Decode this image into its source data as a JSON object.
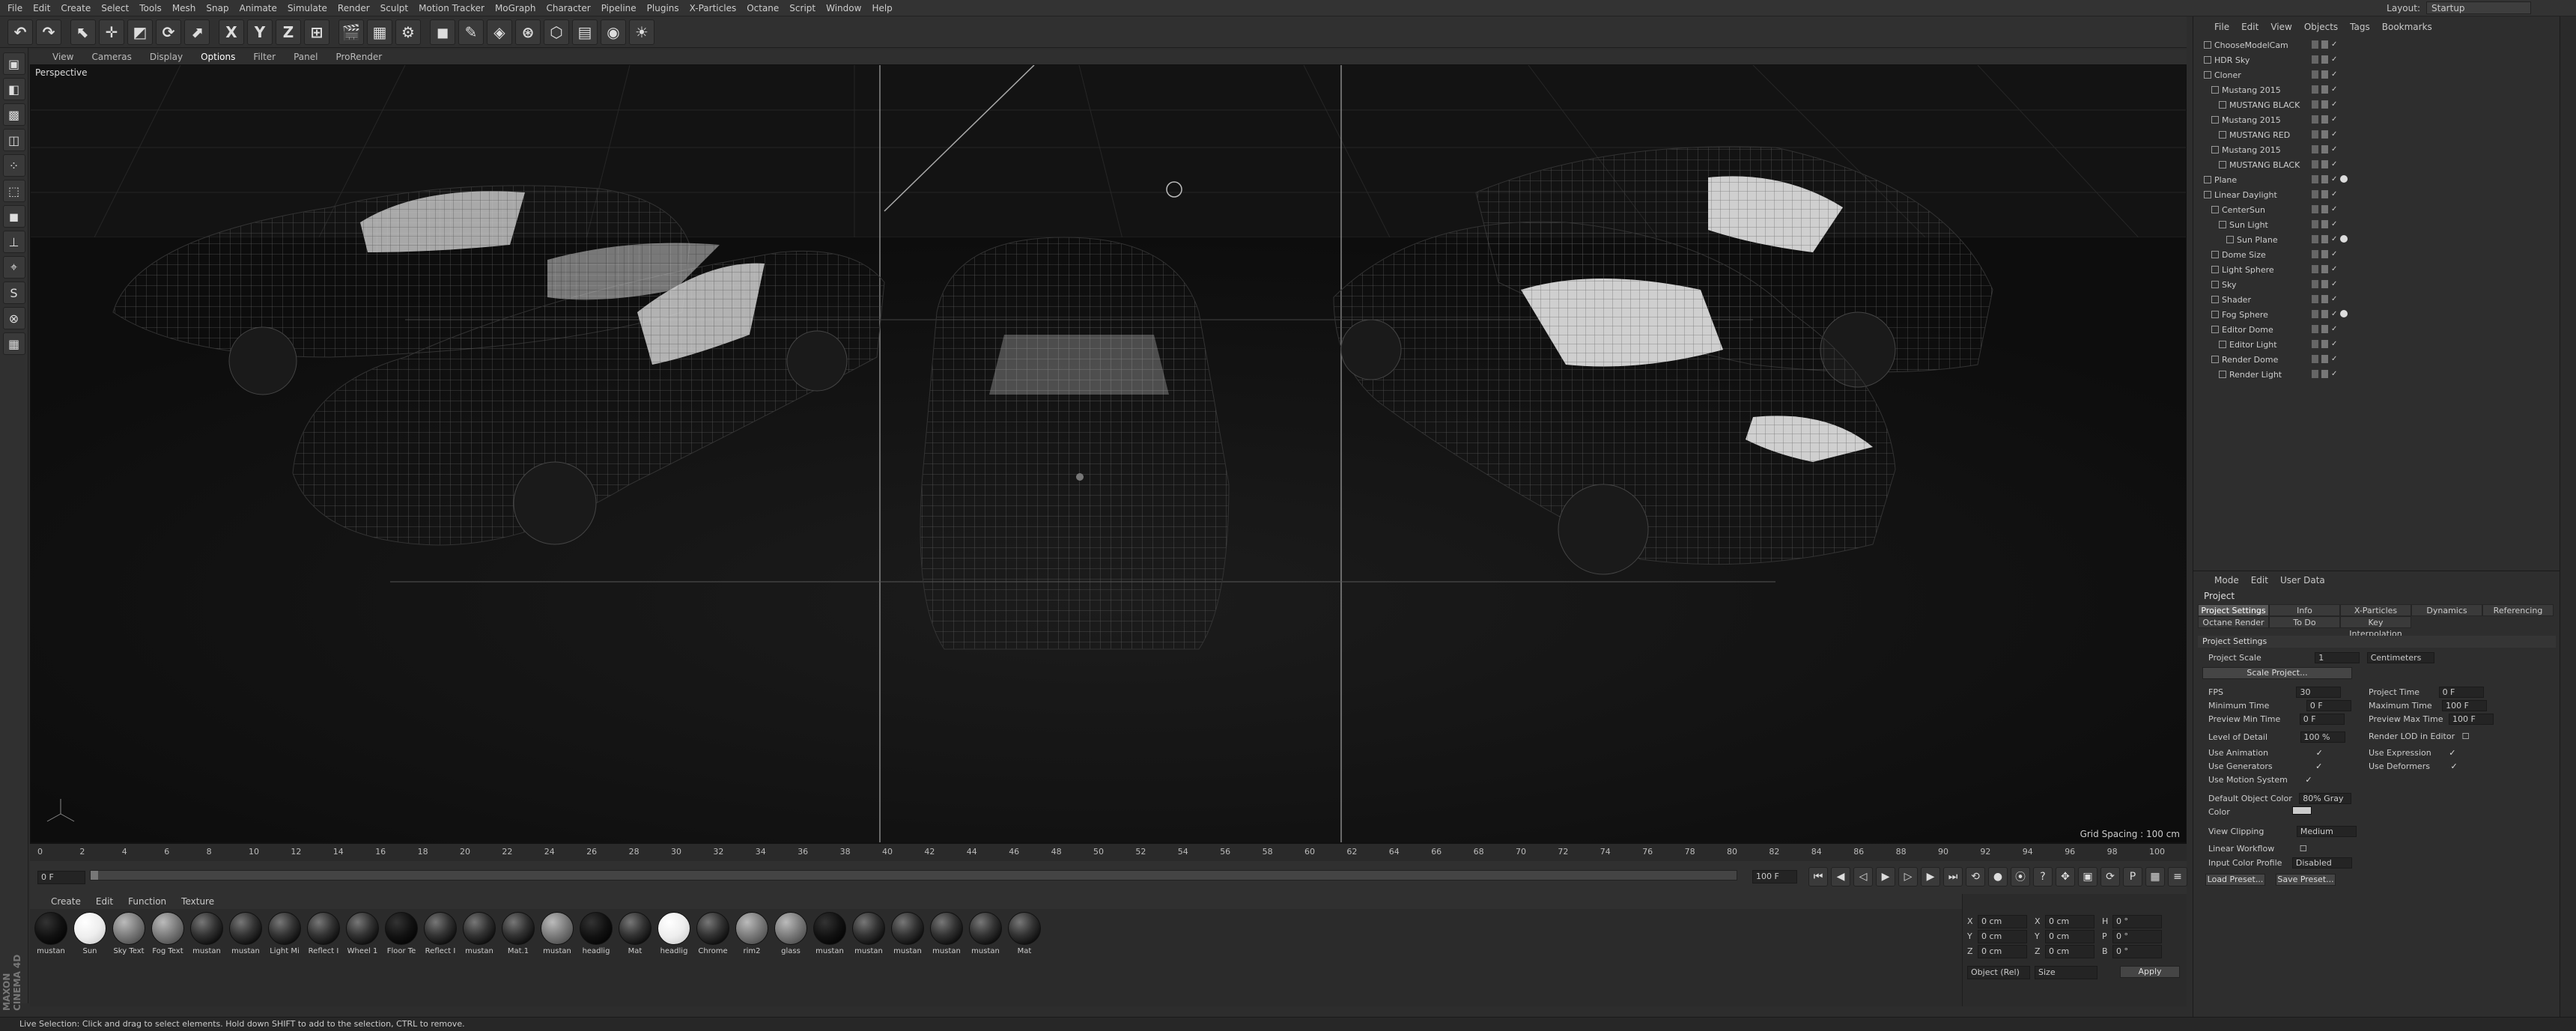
{
  "menubar": {
    "items": [
      "File",
      "Edit",
      "Create",
      "Select",
      "Tools",
      "Mesh",
      "Snap",
      "Animate",
      "Simulate",
      "Render",
      "Sculpt",
      "Motion Tracker",
      "MoGraph",
      "Character",
      "Pipeline",
      "Plugins",
      "X-Particles",
      "Octane",
      "Script",
      "Window",
      "Help"
    ],
    "layout_label": "Layout:",
    "layout_value": "Startup"
  },
  "toolbar": {
    "axis_labels": [
      "X",
      "Y",
      "Z"
    ]
  },
  "viewport": {
    "menu": [
      "View",
      "Cameras",
      "Display",
      "Options",
      "Filter",
      "Panel",
      "ProRender"
    ],
    "name": "Perspective",
    "grid_spacing": "Grid Spacing : 100 cm"
  },
  "timeline": {
    "ticks": [
      "0",
      "2",
      "4",
      "6",
      "8",
      "10",
      "12",
      "14",
      "16",
      "18",
      "20",
      "22",
      "24",
      "26",
      "28",
      "30",
      "32",
      "34",
      "36",
      "38",
      "40",
      "42",
      "44",
      "46",
      "48",
      "50",
      "52",
      "54",
      "56",
      "58",
      "60",
      "62",
      "64",
      "66",
      "68",
      "70",
      "72",
      "74",
      "76",
      "78",
      "80",
      "82",
      "84",
      "86",
      "88",
      "90",
      "92",
      "94",
      "96",
      "98",
      "100"
    ],
    "current_frame": "0 F",
    "end_frame_right": "0 F",
    "start_field": "0 F",
    "end_field": "100 F"
  },
  "material_manager": {
    "menu": [
      "Create",
      "Edit",
      "Function",
      "Texture"
    ],
    "materials": [
      {
        "label": "mustan",
        "style": "dark"
      },
      {
        "label": "Sun",
        "style": "white"
      },
      {
        "label": "Sky Text",
        "style": "grey"
      },
      {
        "label": "Fog Text",
        "style": "grey"
      },
      {
        "label": "mustan",
        "style": "normal"
      },
      {
        "label": "mustan",
        "style": "normal"
      },
      {
        "label": "Light Mi",
        "style": "normal"
      },
      {
        "label": "Reflect I",
        "style": "normal"
      },
      {
        "label": "Wheel 1",
        "style": "normal"
      },
      {
        "label": "Floor Te",
        "style": "dark"
      },
      {
        "label": "Reflect I",
        "style": "normal"
      },
      {
        "label": "mustan",
        "style": "normal"
      },
      {
        "label": "Mat.1",
        "style": "normal"
      },
      {
        "label": "mustan",
        "style": "grey"
      },
      {
        "label": "headlig",
        "style": "dark"
      },
      {
        "label": "Mat",
        "style": "normal"
      },
      {
        "label": "headlig",
        "style": "white"
      },
      {
        "label": "Chrome",
        "style": "normal"
      },
      {
        "label": "rim2",
        "style": "grey"
      },
      {
        "label": "glass",
        "style": "grey"
      },
      {
        "label": "mustan",
        "style": "dark"
      },
      {
        "label": "mustan",
        "style": "normal"
      },
      {
        "label": "mustan",
        "style": "normal"
      },
      {
        "label": "mustan",
        "style": "normal"
      },
      {
        "label": "mustan",
        "style": "normal"
      },
      {
        "label": "Mat",
        "style": "normal"
      }
    ]
  },
  "coords": {
    "rows": [
      {
        "a": "X",
        "av": "0 cm",
        "b": "X",
        "bv": "0 cm",
        "c": "H",
        "cv": "0 °"
      },
      {
        "a": "Y",
        "av": "0 cm",
        "b": "Y",
        "bv": "0 cm",
        "c": "P",
        "cv": "0 °"
      },
      {
        "a": "Z",
        "av": "0 cm",
        "b": "Z",
        "bv": "0 cm",
        "c": "B",
        "cv": "0 °"
      }
    ],
    "mode": "Object (Rel)",
    "size": "Size",
    "apply": "Apply"
  },
  "object_manager": {
    "menu": [
      "File",
      "Edit",
      "View",
      "Objects",
      "Tags",
      "Bookmarks"
    ],
    "objects": [
      {
        "name": "ChooseModelCam",
        "indent": 0
      },
      {
        "name": "HDR Sky",
        "indent": 0
      },
      {
        "name": "Cloner",
        "indent": 0
      },
      {
        "name": "Mustang 2015",
        "indent": 1
      },
      {
        "name": "MUSTANG BLACK",
        "indent": 2
      },
      {
        "name": "Mustang 2015",
        "indent": 1
      },
      {
        "name": "MUSTANG RED",
        "indent": 2
      },
      {
        "name": "Mustang 2015",
        "indent": 1
      },
      {
        "name": "MUSTANG BLACK",
        "indent": 2
      },
      {
        "name": "Plane",
        "indent": 0
      },
      {
        "name": "Linear Daylight",
        "indent": 0
      },
      {
        "name": "CenterSun",
        "indent": 1
      },
      {
        "name": "Sun Light",
        "indent": 2
      },
      {
        "name": "Sun Plane",
        "indent": 3
      },
      {
        "name": "Dome Size",
        "indent": 1
      },
      {
        "name": "Light Sphere",
        "indent": 1
      },
      {
        "name": "Sky",
        "indent": 1
      },
      {
        "name": "Shader",
        "indent": 1
      },
      {
        "name": "Fog Sphere",
        "indent": 1
      },
      {
        "name": "Editor Dome",
        "indent": 1
      },
      {
        "name": "Editor Light",
        "indent": 2
      },
      {
        "name": "Render Dome",
        "indent": 1
      },
      {
        "name": "Render Light",
        "indent": 2
      }
    ]
  },
  "attributes": {
    "menu": [
      "Mode",
      "Edit",
      "User Data"
    ],
    "mode_label": "Project",
    "tabs": [
      "Project Settings",
      "Info",
      "X-Particles",
      "Dynamics",
      "Referencing",
      "Octane Render",
      "To Do",
      "Key Interpolation"
    ],
    "section": "Project Settings",
    "project_scale_label": "Project Scale",
    "project_scale_value": "1",
    "project_scale_unit": "Centimeters",
    "scale_project_button": "Scale Project...",
    "fps_label": "FPS",
    "fps_value": "30",
    "project_time_label": "Project Time",
    "project_time_value": "0 F",
    "min_time_label": "Minimum Time",
    "min_time_value": "0 F",
    "max_time_label": "Maximum Time",
    "max_time_value": "100 F",
    "prev_min_label": "Preview Min Time",
    "prev_min_value": "0 F",
    "prev_max_label": "Preview Max Time",
    "prev_max_value": "100 F",
    "lod_label": "Level of Detail",
    "lod_value": "100 %",
    "render_lod_label": "Render LOD in Editor",
    "use_animation": "Use Animation",
    "use_expression": "Use Expression",
    "use_generators": "Use Generators",
    "use_deformers": "Use Deformers",
    "use_motion": "Use Motion System",
    "default_color_label": "Default Object Color",
    "default_color_value": "80% Gray",
    "color_label": "Color",
    "view_clipping_label": "View Clipping",
    "view_clipping_value": "Medium",
    "linear_workflow_label": "Linear Workflow",
    "input_color_label": "Input Color Profile",
    "input_color_value": "Disabled",
    "load_preset": "Load Preset...",
    "save_preset": "Save Preset..."
  },
  "statusbar": {
    "text": "Live Selection: Click and drag to select elements. Hold down SHIFT to add to the selection, CTRL to remove."
  },
  "branding": "MAXON CINEMA 4D"
}
